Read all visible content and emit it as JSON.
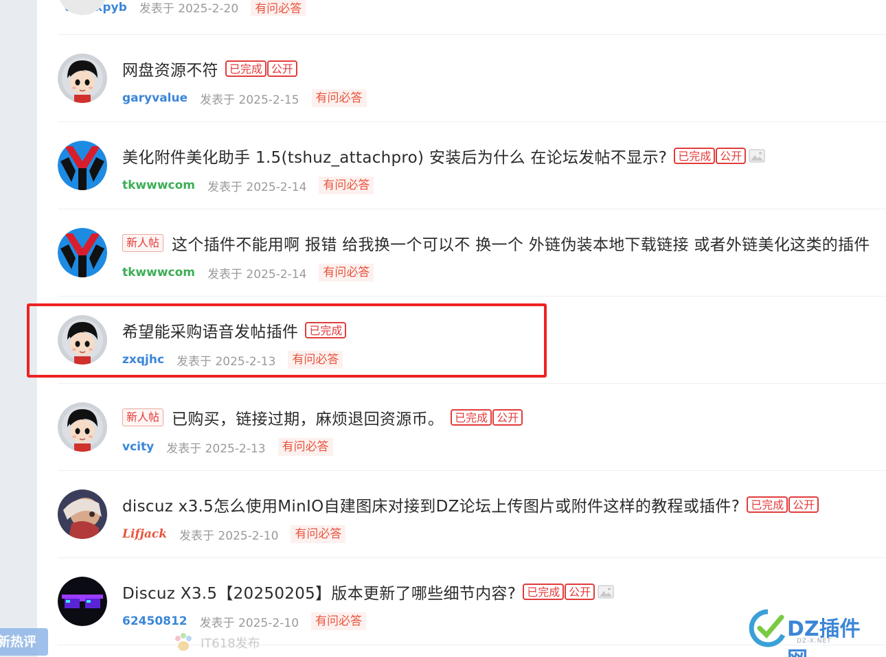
{
  "sidebar": {
    "hot_label": "新热评"
  },
  "colors": {
    "accent_blue": "#3b86d8",
    "tag_red": "#e23b3b",
    "green_user": "#3cae56"
  },
  "partial_row": {
    "user": "uschxpyb",
    "date": "发表于 2025-2-20",
    "category": "有问必答"
  },
  "posts": [
    {
      "title": "网盘资源不符",
      "user": "garyvalue",
      "user_color": "#3b86d8",
      "date": "发表于 2025-2-15",
      "category": "有问必答",
      "new_label": "",
      "tags": [
        "已完成",
        "公开"
      ],
      "has_image": false,
      "avatar": "cartoon-boy"
    },
    {
      "title": "美化附件美化助手 1.5(tshuz_attachpro) 安装后为什么 在论坛发帖不显示?",
      "user": "tkwwwcom",
      "user_color": "#3cae56",
      "date": "发表于 2025-2-14",
      "category": "有问必答",
      "new_label": "",
      "tags": [
        "已完成",
        "公开"
      ],
      "has_image": true,
      "avatar": "red-y-logo"
    },
    {
      "title": "这个插件不能用啊 报错 给我换一个可以不 换一个 外链伪装本地下载链接 或者外链美化这类的插件",
      "user": "tkwwwcom",
      "user_color": "#3cae56",
      "date": "发表于 2025-2-14",
      "category": "有问必答",
      "new_label": "新人帖",
      "tags": [],
      "has_image": false,
      "avatar": "red-y-logo"
    },
    {
      "title": "希望能采购语音发帖插件",
      "user": "zxqjhc",
      "user_color": "#3b86d8",
      "date": "发表于 2025-2-13",
      "category": "有问必答",
      "new_label": "",
      "tags": [
        "已完成"
      ],
      "has_image": false,
      "avatar": "cartoon-boy"
    },
    {
      "title": "已购买，链接过期，麻烦退回资源币。",
      "user": "vcity",
      "user_color": "#3b86d8",
      "date": "发表于 2025-2-13",
      "category": "有问必答",
      "new_label": "新人帖",
      "tags": [
        "已完成",
        "公开"
      ],
      "has_image": false,
      "avatar": "cartoon-boy"
    },
    {
      "title": "discuz x3.5怎么使用MinIO自建图床对接到DZ论坛上传图片或附件这样的教程或插件?",
      "user": "Lifjack",
      "user_color": "#e8533d",
      "date": "发表于 2025-2-10",
      "category": "有问必答",
      "new_label": "",
      "tags": [
        "已完成",
        "公开"
      ],
      "has_image": false,
      "avatar": "photo"
    },
    {
      "title": "Discuz X3.5【20250205】版本更新了哪些细节内容?",
      "user": "62450812",
      "user_color": "#3b86d8",
      "date": "发表于 2025-2-10",
      "category": "有问必答",
      "new_label": "",
      "tags": [
        "已完成",
        "公开"
      ],
      "has_image": true,
      "avatar": "pixel-glasses"
    }
  ],
  "footer": {
    "notice": "IT618发布"
  },
  "watermark": {
    "text": "DZ插件网",
    "sub": "DZ-X.NET"
  }
}
